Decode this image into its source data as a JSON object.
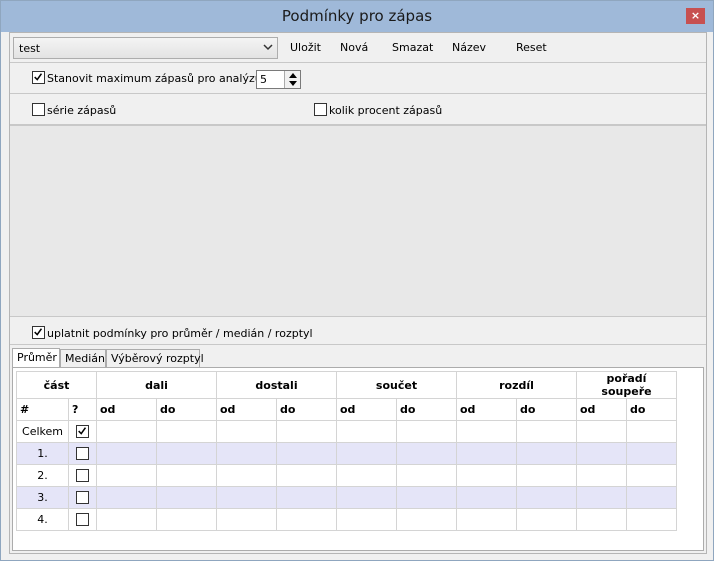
{
  "window": {
    "title": "Podmínky pro zápas",
    "close_label": "×"
  },
  "toolbar": {
    "preset_value": "test",
    "save_label": "Uložit",
    "new_label": "Nová",
    "delete_label": "Smazat",
    "name_label": "Název",
    "reset_label": "Reset"
  },
  "options": {
    "max_matches_label": "Stanovit maximum zápasů pro analýzu",
    "max_matches_checked": true,
    "max_matches_value": "5",
    "series_label": "série zápasů",
    "series_checked": false,
    "percent_label": "kolik procent zápasů",
    "percent_checked": false,
    "apply_conditions_label": "uplatnit podmínky pro průměr / medián / rozptyl",
    "apply_conditions_checked": true
  },
  "tabs": [
    {
      "label": "Průměr",
      "active": true
    },
    {
      "label": "Medián",
      "active": false
    },
    {
      "label": "Výběrový rozptyl",
      "active": false
    }
  ],
  "table": {
    "group_headers": [
      "část",
      "dali",
      "dostali",
      "součet",
      "rozdíl",
      "pořadí soupeře"
    ],
    "sub_headers": [
      "#",
      "?",
      "od",
      "do",
      "od",
      "do",
      "od",
      "do",
      "od",
      "do",
      "od",
      "do"
    ],
    "rows": [
      {
        "label": "Celkem",
        "checked": true
      },
      {
        "label": "1.",
        "checked": false
      },
      {
        "label": "2.",
        "checked": false
      },
      {
        "label": "3.",
        "checked": false
      },
      {
        "label": "4.",
        "checked": false
      }
    ]
  }
}
